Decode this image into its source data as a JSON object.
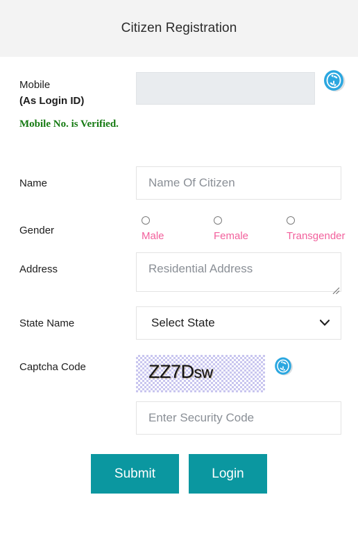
{
  "header": {
    "title": "Citizen Registration"
  },
  "colors": {
    "header_bg": "#f3f3f3",
    "accent_button": "#0b97a0",
    "verified_green": "#157a12",
    "gender_pink": "#f2609c",
    "disabled_field": "#e9ecef",
    "captcha_pattern": "#c9c6ef"
  },
  "form": {
    "mobile": {
      "label_line1": "Mobile",
      "label_line2": "(As Login ID)",
      "value": "",
      "placeholder": "",
      "refresh_icon": "refresh-icon",
      "status_message": "Mobile No. is Verified."
    },
    "name": {
      "label": "Name",
      "value": "",
      "placeholder": "Name Of Citizen"
    },
    "gender": {
      "label": "Gender",
      "options": [
        {
          "label": "Male",
          "selected": false
        },
        {
          "label": "Female",
          "selected": false
        },
        {
          "label": "Transgender",
          "selected": false
        }
      ]
    },
    "address": {
      "label": "Address",
      "value": "",
      "placeholder": "Residential Address"
    },
    "state": {
      "label": "State Name",
      "selected": "Select State",
      "options": [
        "Select State"
      ]
    },
    "captcha": {
      "label": "Captcha Code",
      "code_part1": "ZZ7D",
      "code_part2": "sw",
      "refresh_icon": "refresh-icon",
      "input_value": "",
      "input_placeholder": "Enter Security Code"
    }
  },
  "actions": {
    "submit_label": "Submit",
    "login_label": "Login"
  }
}
